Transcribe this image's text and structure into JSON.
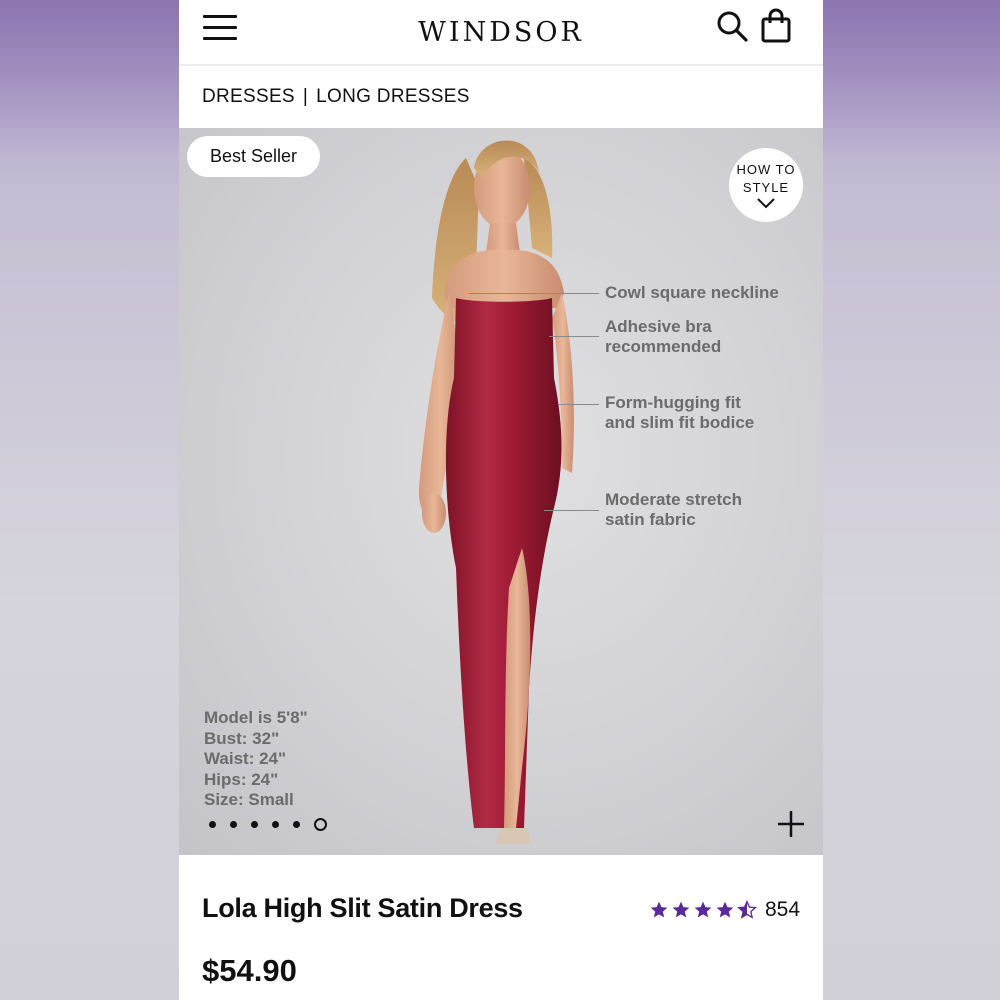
{
  "header": {
    "logo": "windsor",
    "menu_icon": "hamburger-menu-icon",
    "search_icon": "search-icon",
    "bag_icon": "shopping-bag-icon"
  },
  "breadcrumb": {
    "items": [
      "DRESSES",
      "LONG DRESSES"
    ],
    "separator": "|"
  },
  "hero": {
    "badge": "Best Seller",
    "how_to_style": {
      "line1": "HOW TO",
      "line2": "STYLE"
    },
    "callouts": [
      {
        "line1": "Cowl square neckline",
        "line2": ""
      },
      {
        "line1": "Adhesive bra",
        "line2": "recommended"
      },
      {
        "line1": "Form-hugging fit",
        "line2": "and slim fit bodice"
      },
      {
        "line1": "Moderate stretch",
        "line2": "satin fabric"
      }
    ],
    "model_stats": [
      "Model is 5'8\"",
      "Bust: 32\"",
      "Waist: 24\"",
      "Hips: 24\"",
      "Size: Small"
    ],
    "carousel": {
      "total": 6,
      "active_index": 5
    },
    "zoom_icon": "plus-icon"
  },
  "product": {
    "name": "Lola High Slit Satin Dress",
    "rating": 4.5,
    "review_count": "854",
    "price": "$54.90"
  },
  "colors": {
    "star": "#5b2a9a",
    "dress": "#a31b35",
    "background_purple": "#8c75b0"
  }
}
